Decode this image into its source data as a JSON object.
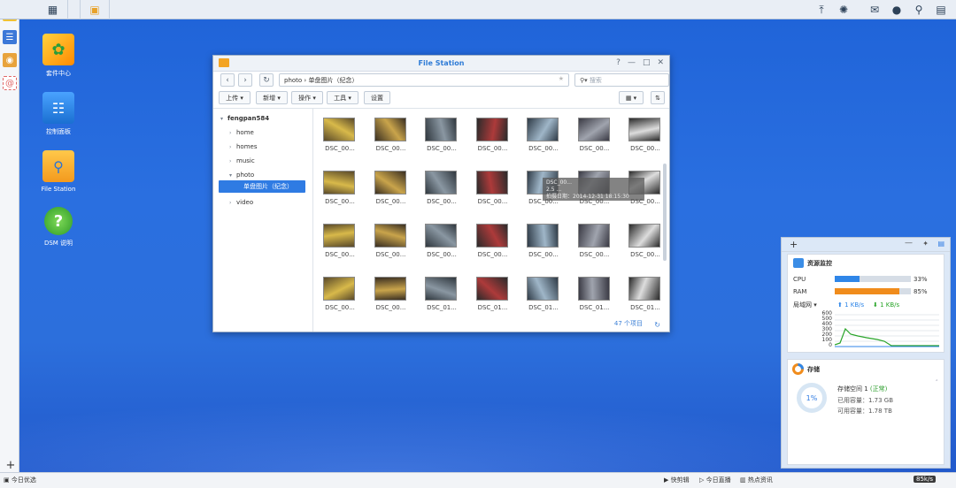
{
  "desktop": {
    "icons": [
      {
        "label": "套件中心",
        "icon": "package-center-icon"
      },
      {
        "label": "控制面板",
        "icon": "control-panel-icon"
      },
      {
        "label": "File Station",
        "icon": "file-station-icon"
      },
      {
        "label": "DSM 说明",
        "icon": "help-icon"
      }
    ]
  },
  "window": {
    "title": "File Station",
    "path": "photo  ›  单盘图片（纪念）",
    "search_placeholder": "搜索",
    "toolbar": [
      "上传",
      "新增",
      "操作",
      "工具",
      "设置"
    ],
    "tree": {
      "root": "fengpan584",
      "items": [
        "home",
        "homes",
        "music",
        "photo",
        "单盘图片（纪念）",
        "video"
      ]
    },
    "files": [
      "DSC_00...",
      "DSC_00...",
      "DSC_00...",
      "DSC_00...",
      "DSC_00...",
      "DSC_00...",
      "DSC_00...",
      "DSC_00...",
      "DSC_00...",
      "DSC_00...",
      "DSC_00...",
      "DSC_00...",
      "DSC_00...",
      "DSC_00...",
      "DSC_00...",
      "DSC_00...",
      "DSC_00...",
      "DSC_00...",
      "DSC_00...",
      "DSC_00...",
      "DSC_00...",
      "DSC_00...",
      "DSC_00...",
      "DSC_01...",
      "DSC_01...",
      "DSC_01...",
      "DSC_01...",
      "DSC_01..."
    ],
    "tooltip": [
      "DSC_00...",
      "2.5 ...",
      "拍摄日期：2014-12-31  18:15:30"
    ],
    "item_count": "47 个项目"
  },
  "monitor": {
    "title": "资源监控",
    "cpu_label": "CPU",
    "cpu_value": "33%",
    "cpu_fraction": 0.33,
    "ram_label": "RAM",
    "ram_value": "85%",
    "ram_fraction": 0.85,
    "net_label": "局域网 ▾",
    "upload": "1 KB/s",
    "download": "1 KB/s",
    "y_ticks": [
      "600",
      "500",
      "400",
      "300",
      "200",
      "100",
      "0"
    ]
  },
  "storage": {
    "title": "存储",
    "percent": "1%",
    "volume": "存储空间 1",
    "status": "(正常)",
    "used": "已用容量：1.73 GB",
    "avail": "可用容量：1.78 TB"
  },
  "taskbar": {
    "left": "今日优选",
    "items": [
      "快剪辑",
      "今日直播",
      "热点资讯"
    ],
    "speed": "85k/s"
  },
  "colors": {
    "accent": "#2f7be3",
    "cpu_bar": "#2f86e8",
    "ram_bar": "#f08c1c",
    "upload": "#2f86e8",
    "download": "#2aa52a"
  }
}
